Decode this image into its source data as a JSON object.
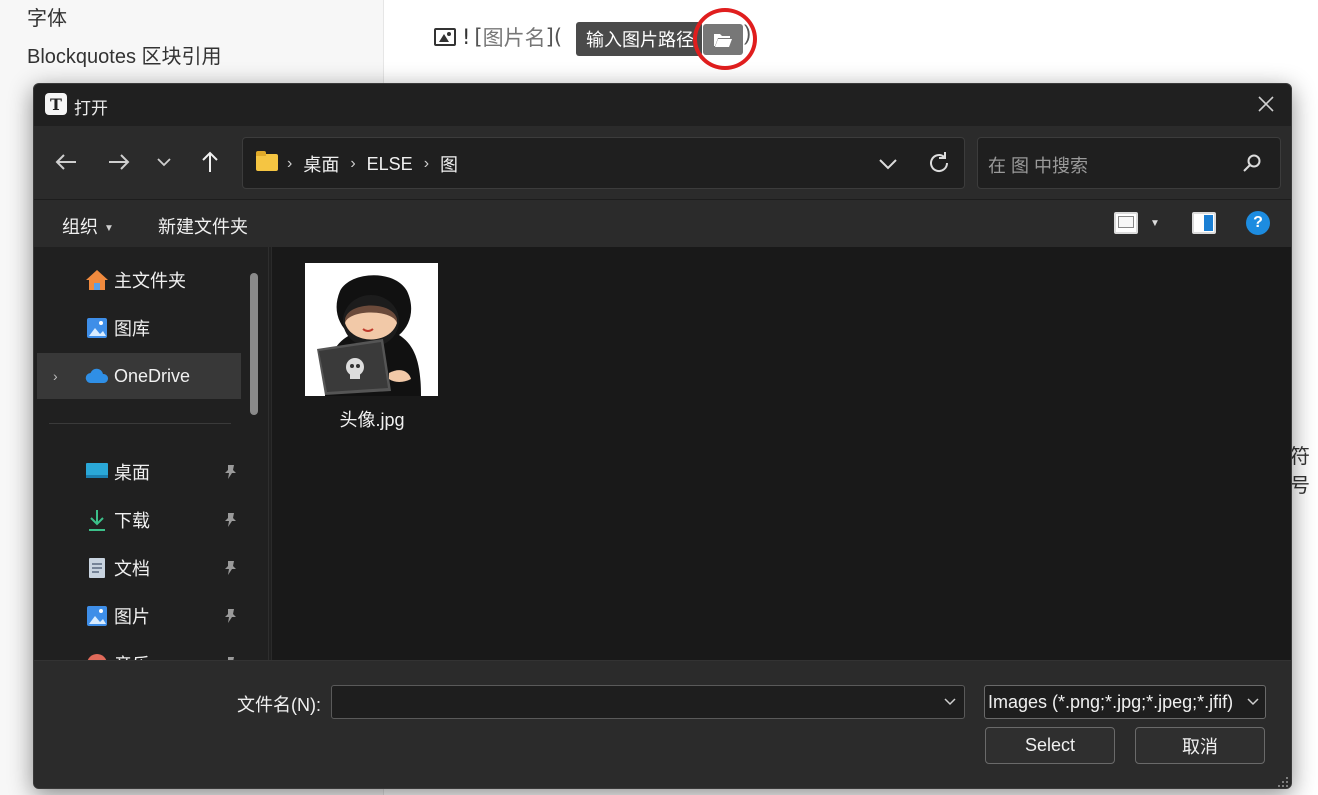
{
  "background": {
    "outline_items": [
      "字体",
      "Blockquotes 区块引用"
    ],
    "image_syntax": {
      "bang": "!",
      "open_bracket": "[",
      "alt": "图片名",
      "close_bracket": "]",
      "open_paren": "(",
      "close_paren": ")"
    },
    "tooltip": "输入图片路径",
    "partial_right_text": "符号"
  },
  "dialog": {
    "title": "打开",
    "app_icon_letter": "T",
    "breadcrumbs": [
      "桌面",
      "ELSE",
      "图"
    ],
    "search_placeholder": "在 图 中搜索",
    "commands": {
      "organize": "组织",
      "new_folder": "新建文件夹",
      "help": "?"
    },
    "nav_items": [
      {
        "label": "主文件夹",
        "icon": "home-icon",
        "pinned": false
      },
      {
        "label": "图库",
        "icon": "gallery-icon",
        "pinned": false
      },
      {
        "label": "OneDrive",
        "icon": "cloud-icon",
        "pinned": false,
        "selected": true
      },
      {
        "label": "桌面",
        "icon": "desktop-icon",
        "pinned": true
      },
      {
        "label": "下载",
        "icon": "download-icon",
        "pinned": true
      },
      {
        "label": "文档",
        "icon": "document-icon",
        "pinned": true
      },
      {
        "label": "图片",
        "icon": "pictures-icon",
        "pinned": true
      },
      {
        "label": "音乐",
        "icon": "music-icon",
        "pinned": true
      }
    ],
    "files": [
      {
        "name": "头像.jpg"
      }
    ],
    "footer": {
      "filename_label": "文件名(N):",
      "filename_value": "",
      "filter": "Images (*.png;*.jpg;*.jpeg;*.jfif)",
      "select_label": "Select",
      "cancel_label": "取消"
    }
  },
  "colors": {
    "accent": "#1d8ce0",
    "dialog_bg": "#202020",
    "annotation": "#e01e1e"
  }
}
